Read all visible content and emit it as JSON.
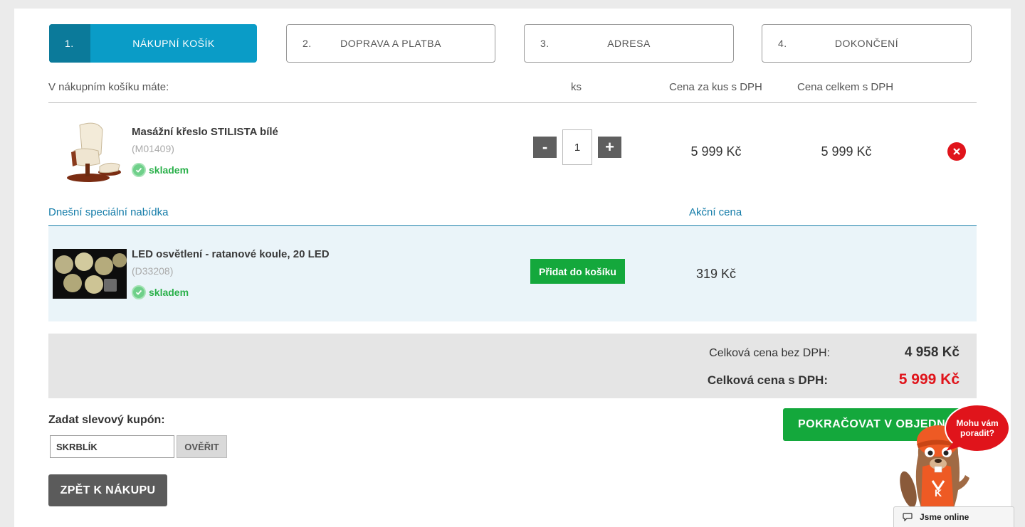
{
  "steps": [
    {
      "num": "1.",
      "label": "NÁKUPNÍ KOŠÍK"
    },
    {
      "num": "2.",
      "label": "DOPRAVA A PLATBA"
    },
    {
      "num": "3.",
      "label": "ADRESA"
    },
    {
      "num": "4.",
      "label": "DOKONČENÍ"
    }
  ],
  "cart_header": {
    "intro": "V nákupním košíku máte:",
    "qty": "ks",
    "unit_price": "Cena za kus s DPH",
    "total_price": "Cena celkem s DPH"
  },
  "cart_item": {
    "name": "Masážní křeslo STILISTA bílé",
    "code": "(M01409)",
    "stock": "skladem",
    "qty": "1",
    "qty_minus": "-",
    "qty_plus": "+",
    "unit_price": "5 999 Kč",
    "total_price": "5 999 Kč"
  },
  "special_offer": {
    "title": "Dnešní speciální nabídka",
    "price_header": "Akční cena",
    "name": "LED osvětlení - ratanové koule, 20 LED",
    "code": "(D33208)",
    "stock": "skladem",
    "add_label": "Přidat do košíku",
    "price": "319 Kč"
  },
  "totals": {
    "without_vat_label": "Celková cena bez DPH:",
    "without_vat_value": "4 958 Kč",
    "with_vat_label": "Celková cena s DPH:",
    "with_vat_value": "5 999 Kč"
  },
  "coupon": {
    "label": "Zadat slevový kupón:",
    "value": "SKRBLÍK",
    "verify_label": "OVĚŘIT"
  },
  "buttons": {
    "back": "ZPĚT K NÁKUPU",
    "continue": "POKRAČOVAT V OBJEDNÁVCE"
  },
  "chat": {
    "bubble_line1": "Mohu vám",
    "bubble_line2": "poradit?",
    "status": "Jsme online"
  },
  "colors": {
    "accent_blue": "#0a9cc7",
    "accent_green": "#14a83c",
    "price_red": "#e0141b"
  }
}
